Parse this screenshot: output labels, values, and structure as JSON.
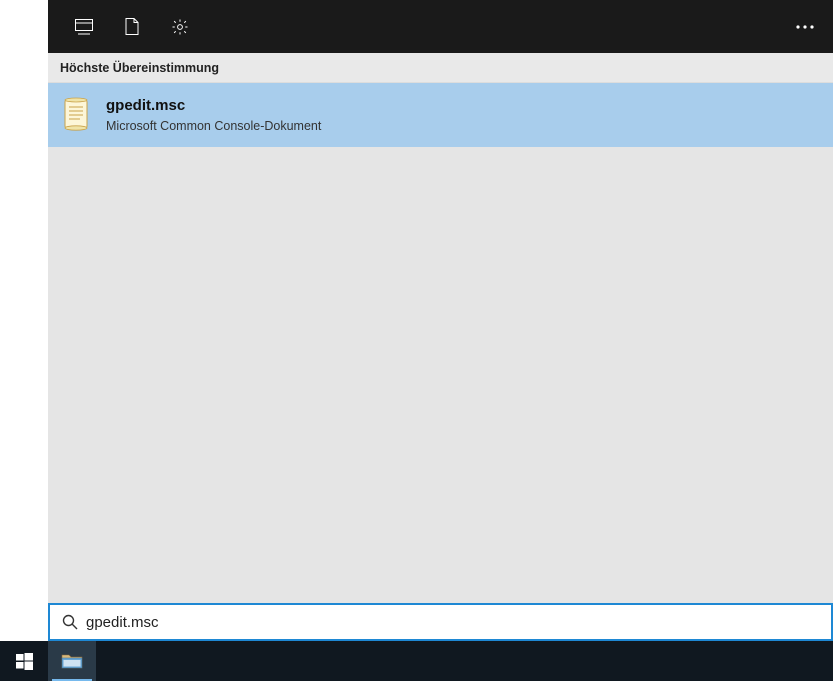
{
  "header": {
    "icons": [
      "apps-icon",
      "document-icon",
      "settings-icon",
      "more-icon"
    ]
  },
  "section": {
    "label": "Höchste Übereinstimmung"
  },
  "result": {
    "title": "gpedit.msc",
    "subtitle": "Microsoft Common Console-Dokument",
    "icon": "document-scroll-icon"
  },
  "search": {
    "value": "gpedit.msc",
    "placeholder": ""
  },
  "taskbar": {
    "items": [
      "start-button",
      "file-explorer-button"
    ]
  }
}
